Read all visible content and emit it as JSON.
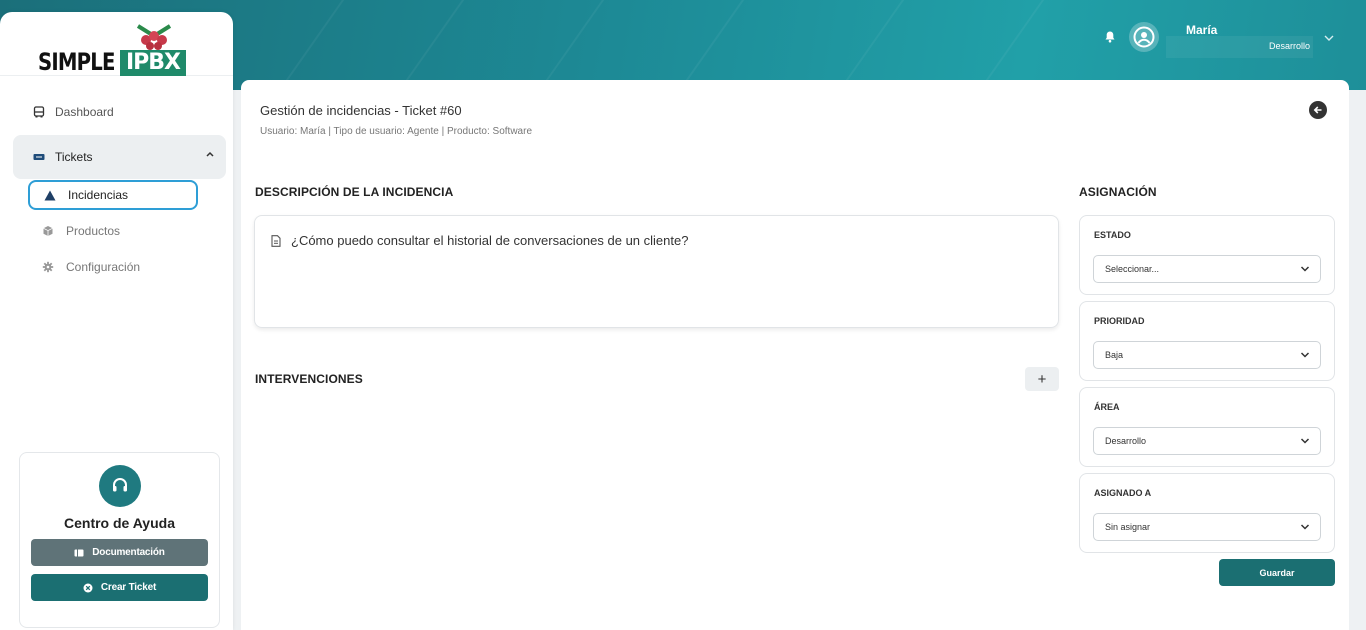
{
  "brand": {
    "logo_left": "SIMPLE",
    "logo_right": "IPBX"
  },
  "sidebar": {
    "items": [
      {
        "label": "Dashboard",
        "icon": "bus-icon"
      },
      {
        "label": "Tickets",
        "icon": "ticket-icon",
        "expanded": true
      }
    ],
    "subitems": [
      {
        "label": "Incidencias",
        "icon": "warning-icon",
        "active": true
      },
      {
        "label": "Productos",
        "icon": "box-icon"
      },
      {
        "label": "Configuración",
        "icon": "gear-icon"
      }
    ]
  },
  "help": {
    "title": "Centro de Ayuda",
    "doc_label": "Documentación",
    "ticket_label": "Crear Ticket"
  },
  "user": {
    "name": "María",
    "role": "Desarrollo"
  },
  "page": {
    "title": "Gestión de incidencias - Ticket #60",
    "subtitle": "Usuario: María | Tipo de usuario: Agente | Producto: Software"
  },
  "description": {
    "heading": "DESCRIPCIÓN DE LA INCIDENCIA",
    "text": "¿Cómo puedo consultar el historial de conversaciones de un cliente?"
  },
  "interventions": {
    "heading": "INTERVENCIONES",
    "add_label": "+"
  },
  "assignment": {
    "heading": "ASIGNACIÓN",
    "fields": [
      {
        "label": "ESTADO",
        "value": "Seleccionar..."
      },
      {
        "label": "PRIORIDAD",
        "value": "Baja"
      },
      {
        "label": "ÁREA",
        "value": "Desarrollo"
      },
      {
        "label": "ASIGNADO A",
        "value": "Sin asignar"
      }
    ],
    "save_label": "Guardar"
  },
  "colors": {
    "accent": "#1b6f72",
    "header": "#1d8a96",
    "active_border": "#2e9ed6"
  }
}
